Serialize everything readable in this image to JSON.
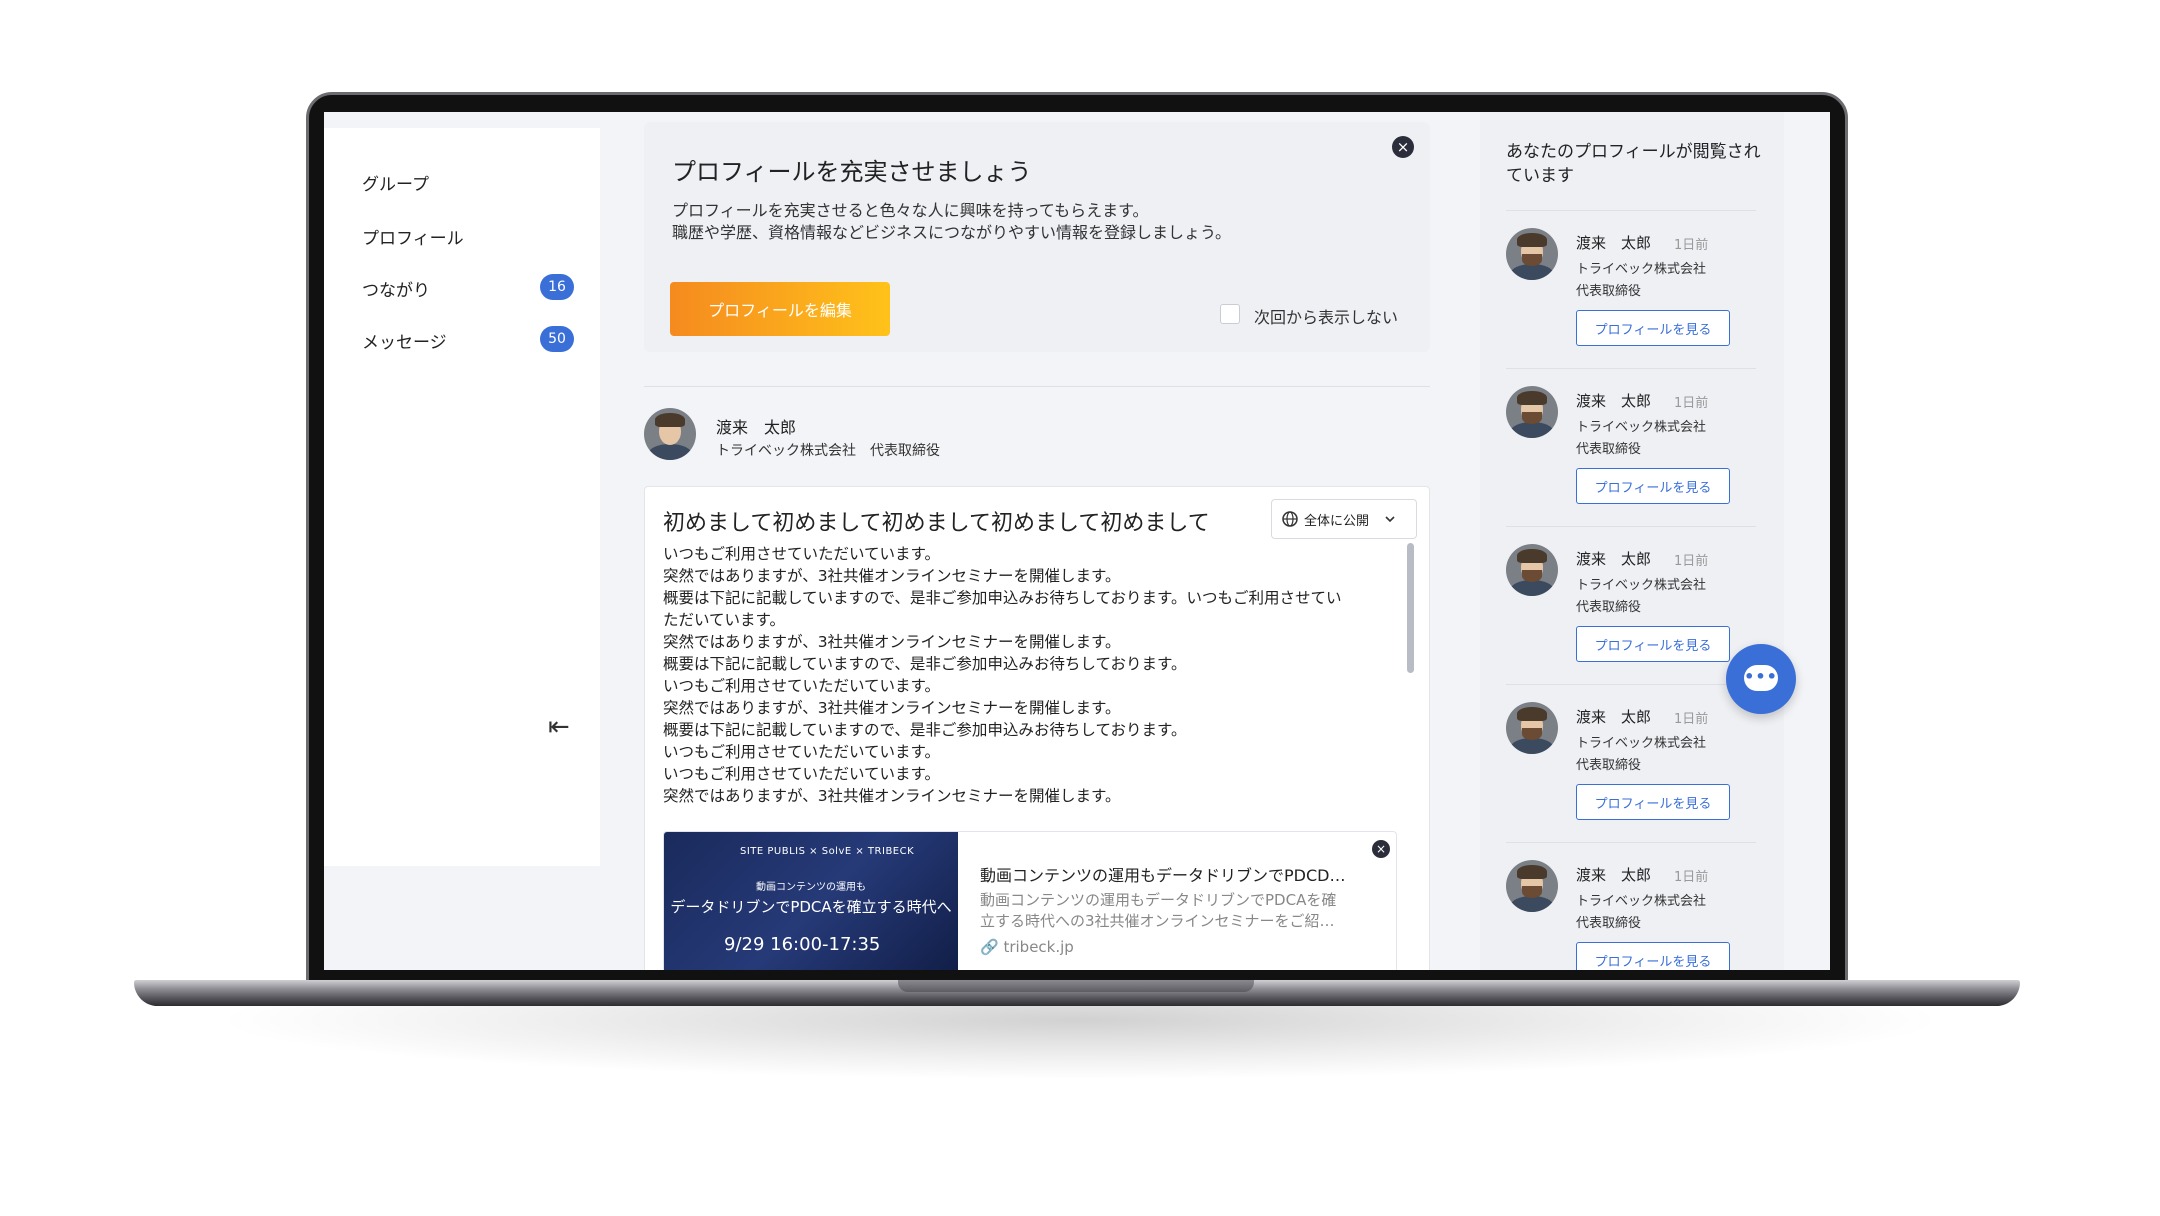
{
  "sidebar": {
    "items": [
      {
        "label": "グループ"
      },
      {
        "label": "プロフィール"
      },
      {
        "label": "つながり",
        "badge": "16"
      },
      {
        "label": "メッセージ",
        "badge": "50"
      }
    ]
  },
  "banner": {
    "title": "プロフィールを充実させましょう",
    "desc_line1": "プロフィールを充実させると色々な人に興味を持ってもらえます。",
    "desc_line2": "職歴や学歴、資格情報などビジネスにつながりやすい情報を登録しましょう。",
    "edit_button": "プロフィールを編集",
    "dont_show_label": "次回から表示しない"
  },
  "post": {
    "author_name": "渡来　太郎",
    "author_company": "トライベック株式会社　代表取締役",
    "title": "初めまして初めまして初めまして初めまして初めまして",
    "visibility": "全体に公開",
    "body": [
      "いつもご利用させていただいています。",
      "突然ではありますが、3社共催オンラインセミナーを開催します。",
      "概要は下記に記載していますので、是非ご参加申込みお待ちしております。いつもご利用させてい",
      "ただいています。",
      "突然ではありますが、3社共催オンラインセミナーを開催します。",
      "概要は下記に記載していますので、是非ご参加申込みお待ちしております。",
      "いつもご利用させていただいています。",
      "突然ではありますが、3社共催オンラインセミナーを開催します。",
      "概要は下記に記載していますので、是非ご参加申込みお待ちしております。",
      "いつもご利用させていただいています。",
      "いつもご利用させていただいています。",
      "突然ではありますが、3社共催オンラインセミナーを開催します。"
    ],
    "link": {
      "thumb_top": "SITE PUBLIS × SolvE × TRIBECK",
      "thumb_mid": "動画コンテンツの運用も",
      "thumb_big": "データドリブンでPDCAを確立する時代へ",
      "thumb_date": "9/29 16:00-17:35",
      "title": "動画コンテンツの運用もデータドリブンでPDCD…",
      "desc_line1": "動画コンテンツの運用もデータドリブンでPDCAを確",
      "desc_line2": "立する時代への3社共催オンラインセミナーをご紹…",
      "domain": "tribeck.jp"
    }
  },
  "right_panel": {
    "title": "あなたのプロフィールが閲覧されています",
    "viewers": [
      {
        "name": "渡来　太郎",
        "time": "1日前",
        "company": "トライベック株式会社",
        "role": "代表取締役",
        "button": "プロフィールを見る"
      },
      {
        "name": "渡来　太郎",
        "time": "1日前",
        "company": "トライベック株式会社",
        "role": "代表取締役",
        "button": "プロフィールを見る"
      },
      {
        "name": "渡来　太郎",
        "time": "1日前",
        "company": "トライベック株式会社",
        "role": "代表取締役",
        "button": "プロフィールを見る"
      },
      {
        "name": "渡来　太郎",
        "time": "1日前",
        "company": "トライベック株式会社",
        "role": "代表取締役",
        "button": "プロフィールを見る"
      },
      {
        "name": "渡来　太郎",
        "time": "1日前",
        "company": "トライベック株式会社",
        "role": "代表取締役",
        "button": "プロフィールを見る"
      }
    ]
  },
  "icons": {
    "close": "close-icon",
    "collapse": "collapse-sidebar-icon",
    "globe": "globe-icon",
    "chevron": "chevron-down-icon",
    "link": "link-icon",
    "chat": "chat-icon"
  },
  "colors": {
    "accent": "#3a6fd8",
    "button_gradient_start": "#f58a1f",
    "button_gradient_end": "#ffc21a"
  }
}
